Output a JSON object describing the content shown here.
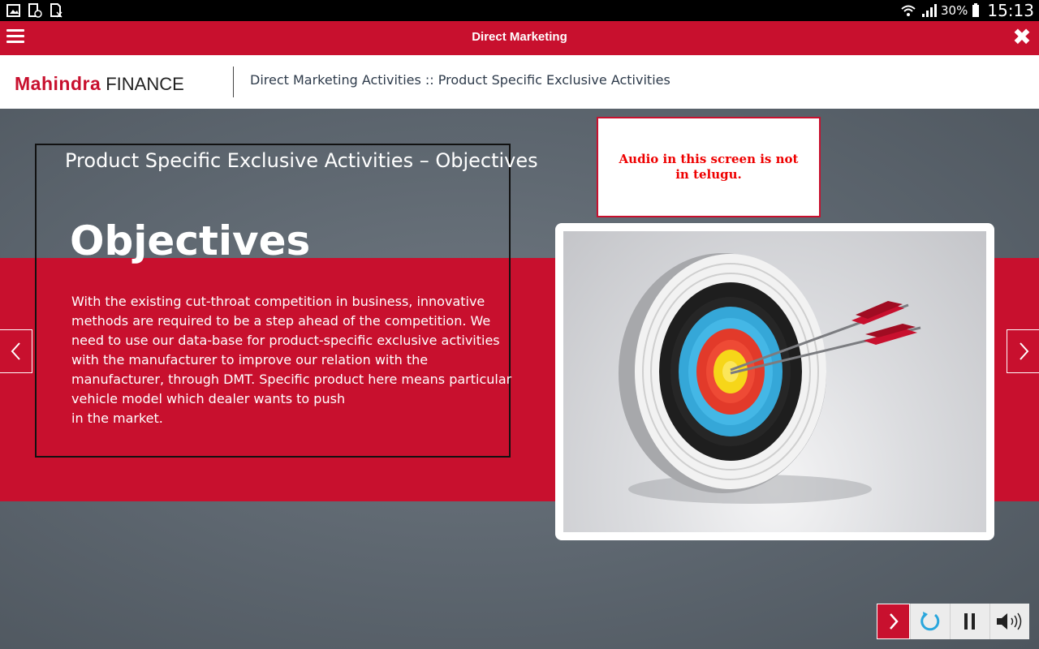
{
  "status_bar": {
    "battery": "30%",
    "time": "15:13"
  },
  "header": {
    "title": "Direct Marketing"
  },
  "brand": {
    "logo_primary": "Mahindra",
    "logo_secondary": "FINANCE",
    "breadcrumb": "Direct Marketing Activities :: Product Specific Exclusive Activities"
  },
  "slide": {
    "title": "Product Specific Exclusive Activities – Objectives",
    "heading": "Objectives",
    "body": "With the existing cut-throat competition in business, innovative methods are required to be a step ahead of the competition. We need to use our data-base for product-specific exclusive activities with the manufacturer to improve our relation with the manufacturer, through DMT. Specific product here means particular vehicle model which dealer wants to push\nin the market.",
    "notice": "Audio in this screen is not in telugu."
  },
  "colors": {
    "brand_red": "#c8102e",
    "notice_text": "#ee0000",
    "background_gray": "#5d666f"
  },
  "icons": {
    "menu": "hamburger-icon",
    "close": "close-icon",
    "prev": "chevron-left-icon",
    "next": "chevron-right-icon",
    "replay": "replay-icon",
    "pause": "pause-icon",
    "volume": "volume-icon"
  }
}
